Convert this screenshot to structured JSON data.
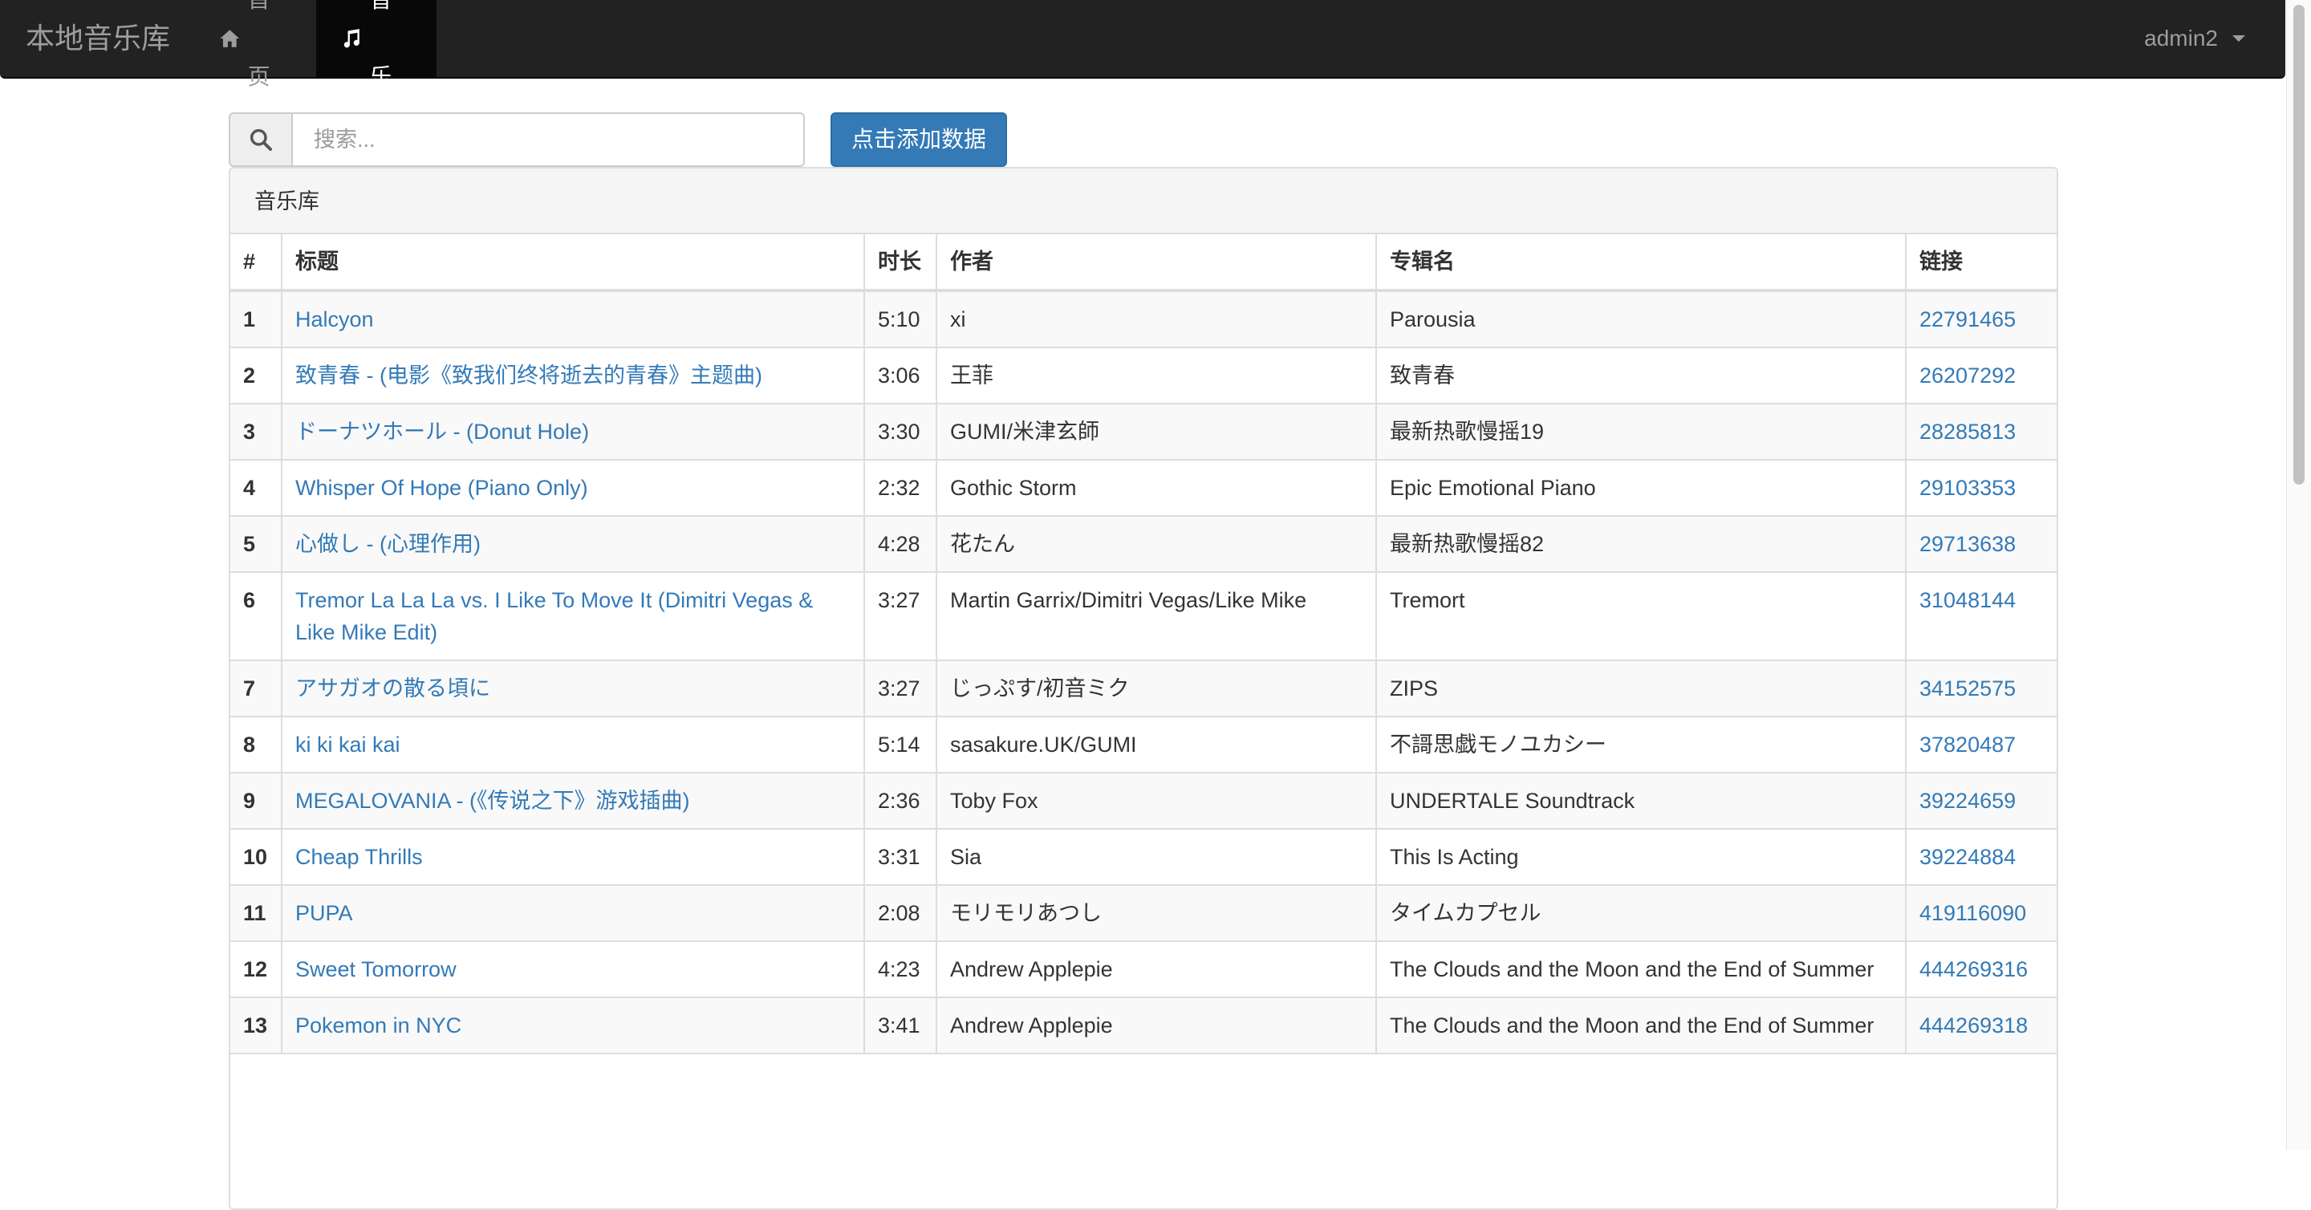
{
  "navbar": {
    "brand": "本地音乐库",
    "home_label": "首页",
    "music_label": "音乐",
    "user_label": "admin2"
  },
  "search": {
    "placeholder": "搜索...",
    "value": ""
  },
  "add_button_label": "点击添加数据",
  "panel_title": "音乐库",
  "table": {
    "headers": [
      "#",
      "标题",
      "时长",
      "作者",
      "专辑名",
      "链接"
    ],
    "rows": [
      {
        "idx": "1",
        "title": "Halcyon",
        "duration": "5:10",
        "artist": "xi",
        "album": "Parousia",
        "link": "22791465"
      },
      {
        "idx": "2",
        "title": "致青春 - (电影《致我们终将逝去的青春》主题曲)",
        "duration": "3:06",
        "artist": "王菲",
        "album": "致青春",
        "link": "26207292"
      },
      {
        "idx": "3",
        "title": "ドーナツホール - (Donut Hole)",
        "duration": "3:30",
        "artist": "GUMI/米津玄師",
        "album": "最新热歌慢摇19",
        "link": "28285813"
      },
      {
        "idx": "4",
        "title": "Whisper Of Hope (Piano Only)",
        "duration": "2:32",
        "artist": "Gothic Storm",
        "album": "Epic Emotional Piano",
        "link": "29103353"
      },
      {
        "idx": "5",
        "title": "心做し - (心理作用)",
        "duration": "4:28",
        "artist": "花たん",
        "album": "最新热歌慢摇82",
        "link": "29713638"
      },
      {
        "idx": "6",
        "title": "Tremor La La La vs. I Like To Move It (Dimitri Vegas & Like Mike Edit)",
        "duration": "3:27",
        "artist": "Martin Garrix/Dimitri Vegas/Like Mike",
        "album": "Tremort",
        "link": "31048144"
      },
      {
        "idx": "7",
        "title": "アサガオの散る頃に",
        "duration": "3:27",
        "artist": "じっぷす/初音ミク",
        "album": "ZIPS",
        "link": "34152575"
      },
      {
        "idx": "8",
        "title": "ki ki kai kai",
        "duration": "5:14",
        "artist": "sasakure.UK/GUMI",
        "album": "不謌思戯モノユカシー",
        "link": "37820487"
      },
      {
        "idx": "9",
        "title": "MEGALOVANIA - (《传说之下》游戏插曲)",
        "duration": "2:36",
        "artist": "Toby Fox",
        "album": "UNDERTALE Soundtrack",
        "link": "39224659"
      },
      {
        "idx": "10",
        "title": "Cheap Thrills",
        "duration": "3:31",
        "artist": "Sia",
        "album": "This Is Acting",
        "link": "39224884"
      },
      {
        "idx": "11",
        "title": "PUPA",
        "duration": "2:08",
        "artist": "モリモリあつし",
        "album": "タイムカプセル",
        "link": "419116090"
      },
      {
        "idx": "12",
        "title": "Sweet Tomorrow",
        "duration": "4:23",
        "artist": "Andrew Applepie",
        "album": "The Clouds and the Moon and the End of Summer",
        "link": "444269316"
      },
      {
        "idx": "13",
        "title": "Pokemon in NYC",
        "duration": "3:41",
        "artist": "Andrew Applepie",
        "album": "The Clouds and the Moon and the End of Summer",
        "link": "444269318"
      }
    ]
  },
  "colors": {
    "navbar_bg": "#222222",
    "link": "#337ab7",
    "primary_button": "#337ab7"
  },
  "icons": {
    "home": "home-icon",
    "music": "music-note-icon",
    "search": "search-icon",
    "user_menu": "caret-down-icon"
  }
}
